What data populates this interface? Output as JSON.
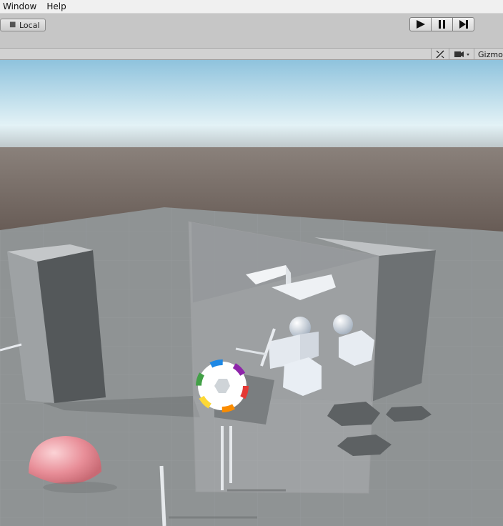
{
  "menu": {
    "items": [
      "Window",
      "Help"
    ]
  },
  "toolbar": {
    "pivot_label": "Local",
    "play_icon": "play-icon",
    "pause_icon": "pause-icon",
    "step_icon": "step-icon"
  },
  "scene_header": {
    "gizmos_label": "Gizmos",
    "tools_icon": "effects-icon",
    "camera_icon": "camera-icon"
  },
  "colors": {
    "sky_top": "#8fc3dd",
    "sky_horizon": "#e3f2f6",
    "ground_far": "#6d615b",
    "floor": "#8f9394",
    "accent_sphere": "#e88e98"
  }
}
